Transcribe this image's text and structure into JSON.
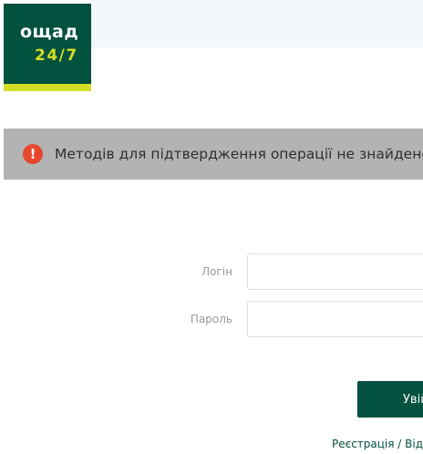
{
  "logo": {
    "name": "ощад",
    "sub": "24/7"
  },
  "alert": {
    "icon": "exclamation-icon",
    "message": "Методів для підтвердження операції не знайдено."
  },
  "form": {
    "login_label": "Логін",
    "login_value": "",
    "password_label": "Пароль",
    "password_value": "",
    "submit_label": "Увійти"
  },
  "links": {
    "register": "Реєстрація",
    "separator": " / ",
    "restore": "Відновлення"
  },
  "colors": {
    "brand": "#03513f",
    "accent": "#d4de25",
    "alert_bg": "#b3b3b3",
    "alert_icon": "#e8462f"
  }
}
